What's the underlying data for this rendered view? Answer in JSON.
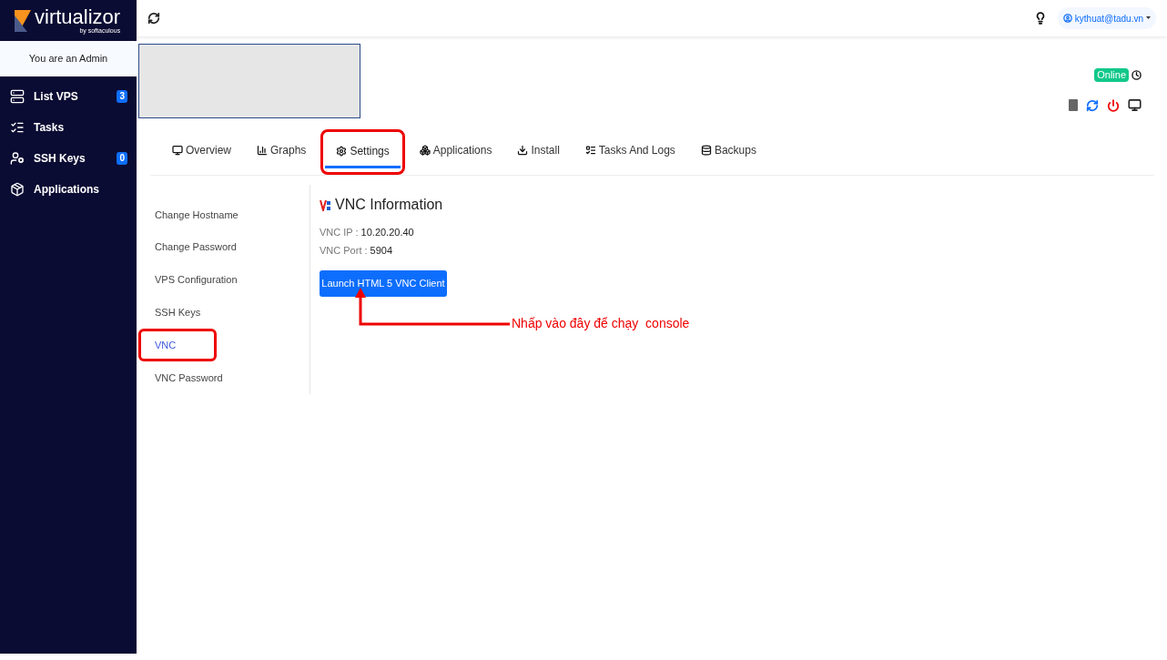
{
  "logo": {
    "name": "virtualizor",
    "tagline": "by softaculous"
  },
  "role_banner": "You are an Admin",
  "sidebar": {
    "items": [
      {
        "label": "List VPS",
        "badge": "3"
      },
      {
        "label": "Tasks"
      },
      {
        "label": "SSH Keys",
        "badge": "0"
      },
      {
        "label": "Applications"
      }
    ]
  },
  "user": {
    "email": "kythuat@tadu.vn"
  },
  "vps": {
    "status": "Online"
  },
  "tabs": [
    {
      "label": "Overview",
      "selected": false,
      "highlighted": false
    },
    {
      "label": "Graphs",
      "selected": false,
      "highlighted": false
    },
    {
      "label": "Settings",
      "selected": true,
      "highlighted": true
    },
    {
      "label": "Applications",
      "selected": false,
      "highlighted": false
    },
    {
      "label": "Install",
      "selected": false,
      "highlighted": false
    },
    {
      "label": "Tasks And Logs",
      "selected": false,
      "highlighted": false
    },
    {
      "label": "Backups",
      "selected": false,
      "highlighted": false
    }
  ],
  "settings_menu": [
    {
      "label": "Change Hostname",
      "selected": false,
      "highlighted": false
    },
    {
      "label": "Change Password",
      "selected": false,
      "highlighted": false
    },
    {
      "label": "VPS Configuration",
      "selected": false,
      "highlighted": false
    },
    {
      "label": "SSH Keys",
      "selected": false,
      "highlighted": false
    },
    {
      "label": "VNC",
      "selected": true,
      "highlighted": true
    },
    {
      "label": "VNC Password",
      "selected": false,
      "highlighted": false
    }
  ],
  "vnc": {
    "title": "VNC Information",
    "fields": [
      {
        "label": "VNC IP :",
        "value": "10.20.20.40"
      },
      {
        "label": "VNC Port :",
        "value": "5904"
      }
    ],
    "button": "Launch HTML 5 VNC Client"
  },
  "annotation": {
    "text": "Nhấp vào đây để chạy  console"
  }
}
